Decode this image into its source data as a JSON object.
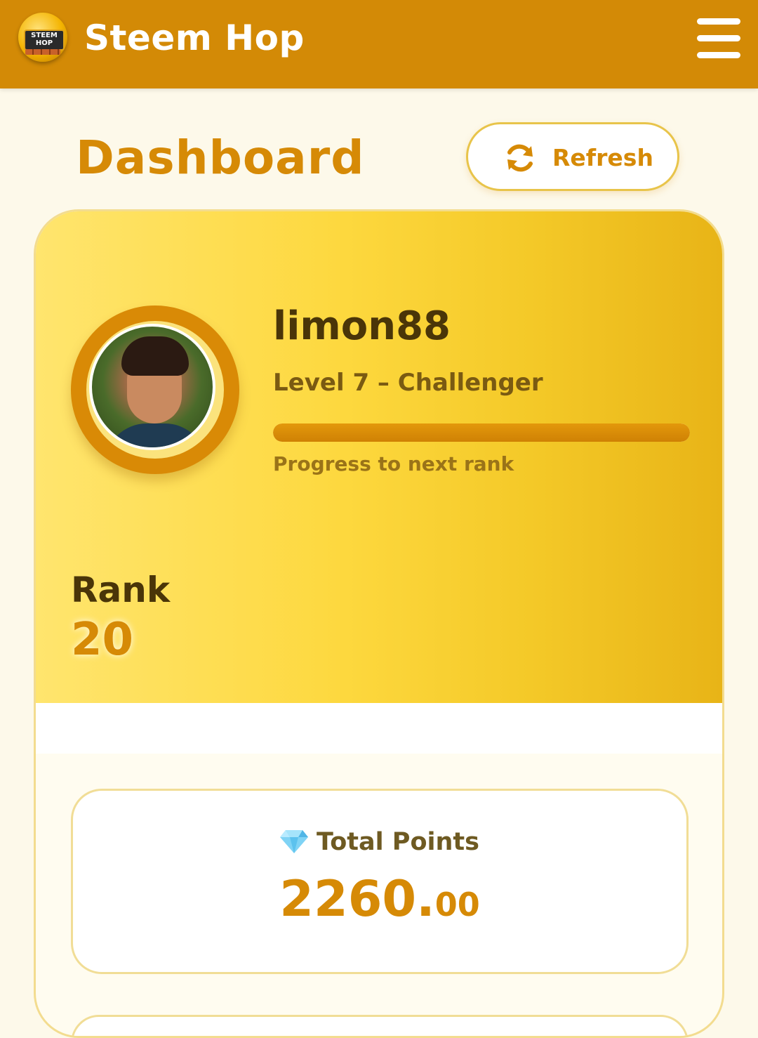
{
  "app": {
    "title": "Steem Hop",
    "logo_text": "STEEM\nHOP"
  },
  "header": {
    "page_title": "Dashboard",
    "refresh_label": "Refresh"
  },
  "profile": {
    "username": "limon88",
    "level_text": "Level 7 – Challenger",
    "progress_fraction": 1.0,
    "progress_label": "Progress to next rank",
    "rank_label": "Rank",
    "rank_value": "20"
  },
  "stats": {
    "total_points_label": "Total Points",
    "total_points_integer": "2260.",
    "total_points_decimal": "00"
  },
  "colors": {
    "header_bg": "#d38a06",
    "accent": "#d68a06",
    "page_bg": "#fdf9ea",
    "hero_gradient_start": "#ffe56e",
    "hero_gradient_end": "#e8b417"
  },
  "icons": {
    "logo": "steem-hop-logo-icon",
    "menu": "hamburger-menu-icon",
    "refresh": "refresh-icon",
    "gem": "gem-icon"
  }
}
